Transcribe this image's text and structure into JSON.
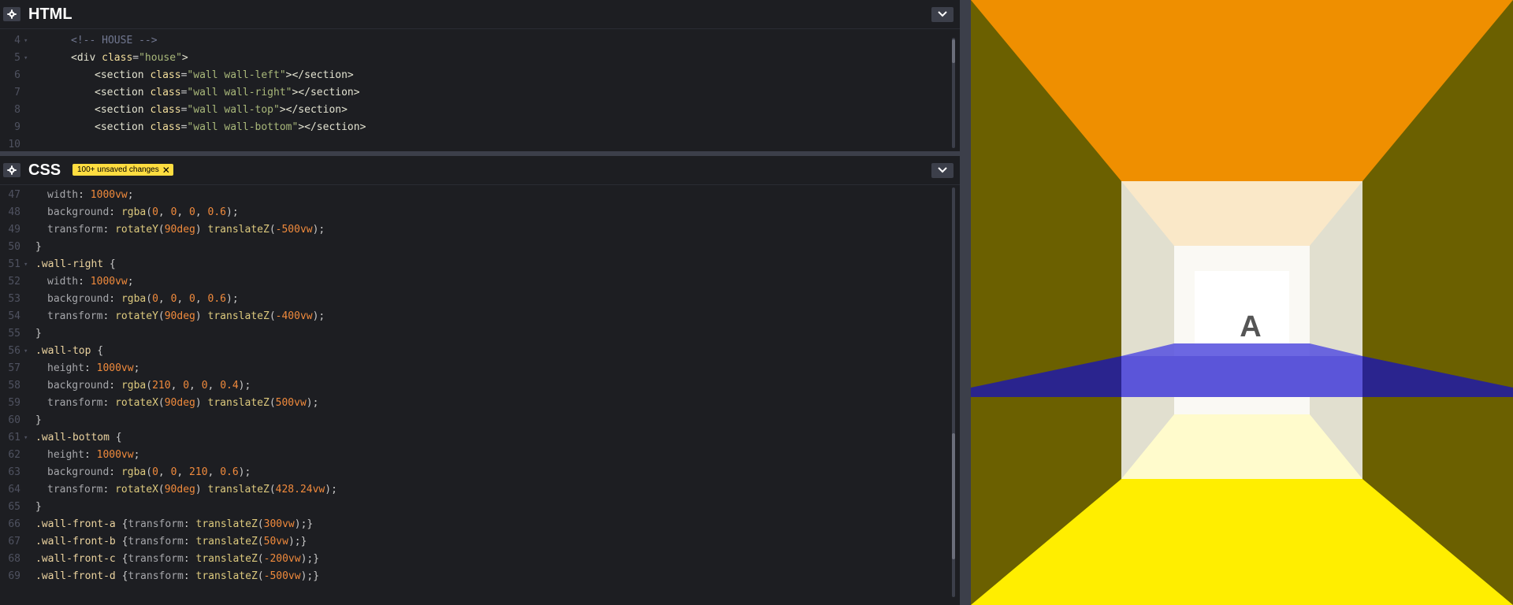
{
  "html_panel": {
    "title": "HTML",
    "lines": [
      {
        "n": "4",
        "fold": true,
        "indent": 3,
        "tokens": [
          {
            "t": "<!-- HOUSE -->",
            "c": "com"
          }
        ]
      },
      {
        "n": "5",
        "fold": true,
        "indent": 3,
        "tokens": [
          {
            "t": "<div ",
            "c": "tag"
          },
          {
            "t": "class",
            "c": "attr"
          },
          {
            "t": "=",
            "c": "punc"
          },
          {
            "t": "\"house\"",
            "c": "str"
          },
          {
            "t": ">",
            "c": "tag"
          }
        ]
      },
      {
        "n": "6",
        "fold": false,
        "indent": 5,
        "tokens": [
          {
            "t": "<section ",
            "c": "tag"
          },
          {
            "t": "class",
            "c": "attr"
          },
          {
            "t": "=",
            "c": "punc"
          },
          {
            "t": "\"wall wall-left\"",
            "c": "str"
          },
          {
            "t": "></section>",
            "c": "tag"
          }
        ]
      },
      {
        "n": "7",
        "fold": false,
        "indent": 5,
        "tokens": [
          {
            "t": "<section ",
            "c": "tag"
          },
          {
            "t": "class",
            "c": "attr"
          },
          {
            "t": "=",
            "c": "punc"
          },
          {
            "t": "\"wall wall-right\"",
            "c": "str"
          },
          {
            "t": "></section>",
            "c": "tag"
          }
        ]
      },
      {
        "n": "8",
        "fold": false,
        "indent": 5,
        "tokens": [
          {
            "t": "<section ",
            "c": "tag"
          },
          {
            "t": "class",
            "c": "attr"
          },
          {
            "t": "=",
            "c": "punc"
          },
          {
            "t": "\"wall wall-top\"",
            "c": "str"
          },
          {
            "t": "></section>",
            "c": "tag"
          }
        ]
      },
      {
        "n": "9",
        "fold": false,
        "indent": 5,
        "tokens": [
          {
            "t": "<section ",
            "c": "tag"
          },
          {
            "t": "class",
            "c": "attr"
          },
          {
            "t": "=",
            "c": "punc"
          },
          {
            "t": "\"wall wall-bottom\"",
            "c": "str"
          },
          {
            "t": "></section>",
            "c": "tag"
          }
        ]
      },
      {
        "n": "10",
        "fold": false,
        "indent": 0,
        "tokens": []
      }
    ]
  },
  "css_panel": {
    "title": "CSS",
    "badge": "100+ unsaved changes",
    "lines": [
      {
        "n": "47",
        "fold": false,
        "indent": 1,
        "tokens": [
          {
            "t": "width",
            "c": "prop"
          },
          {
            "t": ": ",
            "c": "punc"
          },
          {
            "t": "1000vw",
            "c": "num"
          },
          {
            "t": ";",
            "c": "punc"
          }
        ]
      },
      {
        "n": "48",
        "fold": false,
        "indent": 1,
        "tokens": [
          {
            "t": "background",
            "c": "prop"
          },
          {
            "t": ": ",
            "c": "punc"
          },
          {
            "t": "rgba",
            "c": "fn"
          },
          {
            "t": "(",
            "c": "punc"
          },
          {
            "t": "0",
            "c": "num"
          },
          {
            "t": ", ",
            "c": "punc"
          },
          {
            "t": "0",
            "c": "num"
          },
          {
            "t": ", ",
            "c": "punc"
          },
          {
            "t": "0",
            "c": "num"
          },
          {
            "t": ", ",
            "c": "punc"
          },
          {
            "t": "0.6",
            "c": "num"
          },
          {
            "t": ");",
            "c": "punc"
          }
        ]
      },
      {
        "n": "49",
        "fold": false,
        "indent": 1,
        "tokens": [
          {
            "t": "transform",
            "c": "prop"
          },
          {
            "t": ": ",
            "c": "punc"
          },
          {
            "t": "rotateY",
            "c": "fn"
          },
          {
            "t": "(",
            "c": "punc"
          },
          {
            "t": "90deg",
            "c": "num"
          },
          {
            "t": ") ",
            "c": "punc"
          },
          {
            "t": "translateZ",
            "c": "fn"
          },
          {
            "t": "(",
            "c": "punc"
          },
          {
            "t": "-500vw",
            "c": "num"
          },
          {
            "t": ");",
            "c": "punc"
          }
        ]
      },
      {
        "n": "50",
        "fold": false,
        "indent": 0,
        "tokens": [
          {
            "t": "}",
            "c": "punc"
          }
        ]
      },
      {
        "n": "51",
        "fold": true,
        "indent": 0,
        "tokens": [
          {
            "t": ".wall-right",
            "c": "sel"
          },
          {
            "t": " {",
            "c": "punc"
          }
        ]
      },
      {
        "n": "52",
        "fold": false,
        "indent": 1,
        "tokens": [
          {
            "t": "width",
            "c": "prop"
          },
          {
            "t": ": ",
            "c": "punc"
          },
          {
            "t": "1000vw",
            "c": "num"
          },
          {
            "t": ";",
            "c": "punc"
          }
        ]
      },
      {
        "n": "53",
        "fold": false,
        "indent": 1,
        "tokens": [
          {
            "t": "background",
            "c": "prop"
          },
          {
            "t": ": ",
            "c": "punc"
          },
          {
            "t": "rgba",
            "c": "fn"
          },
          {
            "t": "(",
            "c": "punc"
          },
          {
            "t": "0",
            "c": "num"
          },
          {
            "t": ", ",
            "c": "punc"
          },
          {
            "t": "0",
            "c": "num"
          },
          {
            "t": ", ",
            "c": "punc"
          },
          {
            "t": "0",
            "c": "num"
          },
          {
            "t": ", ",
            "c": "punc"
          },
          {
            "t": "0.6",
            "c": "num"
          },
          {
            "t": ");",
            "c": "punc"
          }
        ]
      },
      {
        "n": "54",
        "fold": false,
        "indent": 1,
        "tokens": [
          {
            "t": "transform",
            "c": "prop"
          },
          {
            "t": ": ",
            "c": "punc"
          },
          {
            "t": "rotateY",
            "c": "fn"
          },
          {
            "t": "(",
            "c": "punc"
          },
          {
            "t": "90deg",
            "c": "num"
          },
          {
            "t": ") ",
            "c": "punc"
          },
          {
            "t": "translateZ",
            "c": "fn"
          },
          {
            "t": "(",
            "c": "punc"
          },
          {
            "t": "-400vw",
            "c": "num"
          },
          {
            "t": ");",
            "c": "punc"
          }
        ]
      },
      {
        "n": "55",
        "fold": false,
        "indent": 0,
        "tokens": [
          {
            "t": "}",
            "c": "punc"
          }
        ]
      },
      {
        "n": "56",
        "fold": true,
        "indent": 0,
        "tokens": [
          {
            "t": ".wall-top",
            "c": "sel"
          },
          {
            "t": " {",
            "c": "punc"
          }
        ]
      },
      {
        "n": "57",
        "fold": false,
        "indent": 1,
        "tokens": [
          {
            "t": "height",
            "c": "prop"
          },
          {
            "t": ": ",
            "c": "punc"
          },
          {
            "t": "1000vw",
            "c": "num"
          },
          {
            "t": ";",
            "c": "punc"
          }
        ]
      },
      {
        "n": "58",
        "fold": false,
        "indent": 1,
        "tokens": [
          {
            "t": "background",
            "c": "prop"
          },
          {
            "t": ": ",
            "c": "punc"
          },
          {
            "t": "rgba",
            "c": "fn"
          },
          {
            "t": "(",
            "c": "punc"
          },
          {
            "t": "210",
            "c": "num"
          },
          {
            "t": ", ",
            "c": "punc"
          },
          {
            "t": "0",
            "c": "num"
          },
          {
            "t": ", ",
            "c": "punc"
          },
          {
            "t": "0",
            "c": "num"
          },
          {
            "t": ", ",
            "c": "punc"
          },
          {
            "t": "0.4",
            "c": "num"
          },
          {
            "t": ");",
            "c": "punc"
          }
        ]
      },
      {
        "n": "59",
        "fold": false,
        "indent": 1,
        "tokens": [
          {
            "t": "transform",
            "c": "prop"
          },
          {
            "t": ": ",
            "c": "punc"
          },
          {
            "t": "rotateX",
            "c": "fn"
          },
          {
            "t": "(",
            "c": "punc"
          },
          {
            "t": "90deg",
            "c": "num"
          },
          {
            "t": ") ",
            "c": "punc"
          },
          {
            "t": "translateZ",
            "c": "fn"
          },
          {
            "t": "(",
            "c": "punc"
          },
          {
            "t": "500vw",
            "c": "num"
          },
          {
            "t": ");",
            "c": "punc"
          }
        ]
      },
      {
        "n": "60",
        "fold": false,
        "indent": 0,
        "tokens": [
          {
            "t": "}",
            "c": "punc"
          }
        ]
      },
      {
        "n": "61",
        "fold": true,
        "indent": 0,
        "tokens": [
          {
            "t": ".wall-bottom",
            "c": "sel"
          },
          {
            "t": " {",
            "c": "punc"
          }
        ]
      },
      {
        "n": "62",
        "fold": false,
        "indent": 1,
        "tokens": [
          {
            "t": "height",
            "c": "prop"
          },
          {
            "t": ": ",
            "c": "punc"
          },
          {
            "t": "1000vw",
            "c": "num"
          },
          {
            "t": ";",
            "c": "punc"
          }
        ]
      },
      {
        "n": "63",
        "fold": false,
        "indent": 1,
        "tokens": [
          {
            "t": "background",
            "c": "prop"
          },
          {
            "t": ": ",
            "c": "punc"
          },
          {
            "t": "rgba",
            "c": "fn"
          },
          {
            "t": "(",
            "c": "punc"
          },
          {
            "t": "0",
            "c": "num"
          },
          {
            "t": ", ",
            "c": "punc"
          },
          {
            "t": "0",
            "c": "num"
          },
          {
            "t": ", ",
            "c": "punc"
          },
          {
            "t": "210",
            "c": "num"
          },
          {
            "t": ", ",
            "c": "punc"
          },
          {
            "t": "0.6",
            "c": "num"
          },
          {
            "t": ");",
            "c": "punc"
          }
        ]
      },
      {
        "n": "64",
        "fold": false,
        "indent": 1,
        "tokens": [
          {
            "t": "transform",
            "c": "prop"
          },
          {
            "t": ": ",
            "c": "punc"
          },
          {
            "t": "rotateX",
            "c": "fn"
          },
          {
            "t": "(",
            "c": "punc"
          },
          {
            "t": "90deg",
            "c": "num"
          },
          {
            "t": ") ",
            "c": "punc"
          },
          {
            "t": "translateZ",
            "c": "fn"
          },
          {
            "t": "(",
            "c": "punc"
          },
          {
            "t": "428.24vw",
            "c": "num"
          },
          {
            "t": ");",
            "c": "punc"
          }
        ]
      },
      {
        "n": "65",
        "fold": false,
        "indent": 0,
        "tokens": [
          {
            "t": "}",
            "c": "punc"
          }
        ]
      },
      {
        "n": "66",
        "fold": false,
        "indent": 0,
        "tokens": [
          {
            "t": ".wall-front-a",
            "c": "sel"
          },
          {
            "t": " {",
            "c": "punc"
          },
          {
            "t": "transform",
            "c": "prop"
          },
          {
            "t": ": ",
            "c": "punc"
          },
          {
            "t": "translateZ",
            "c": "fn"
          },
          {
            "t": "(",
            "c": "punc"
          },
          {
            "t": "300vw",
            "c": "num"
          },
          {
            "t": ");}",
            "c": "punc"
          }
        ]
      },
      {
        "n": "67",
        "fold": false,
        "indent": 0,
        "tokens": [
          {
            "t": ".wall-front-b",
            "c": "sel"
          },
          {
            "t": " {",
            "c": "punc"
          },
          {
            "t": "transform",
            "c": "prop"
          },
          {
            "t": ": ",
            "c": "punc"
          },
          {
            "t": "translateZ",
            "c": "fn"
          },
          {
            "t": "(",
            "c": "punc"
          },
          {
            "t": "50vw",
            "c": "num"
          },
          {
            "t": ");}",
            "c": "punc"
          }
        ]
      },
      {
        "n": "68",
        "fold": false,
        "indent": 0,
        "tokens": [
          {
            "t": ".wall-front-c",
            "c": "sel"
          },
          {
            "t": " {",
            "c": "punc"
          },
          {
            "t": "transform",
            "c": "prop"
          },
          {
            "t": ": ",
            "c": "punc"
          },
          {
            "t": "translateZ",
            "c": "fn"
          },
          {
            "t": "(",
            "c": "punc"
          },
          {
            "t": "-200vw",
            "c": "num"
          },
          {
            "t": ");}",
            "c": "punc"
          }
        ]
      },
      {
        "n": "69",
        "fold": false,
        "indent": 0,
        "tokens": [
          {
            "t": ".wall-front-d",
            "c": "sel"
          },
          {
            "t": " {",
            "c": "punc"
          },
          {
            "t": "transform",
            "c": "prop"
          },
          {
            "t": ": ",
            "c": "punc"
          },
          {
            "t": "translateZ",
            "c": "fn"
          },
          {
            "t": "(",
            "c": "punc"
          },
          {
            "t": "-500vw",
            "c": "num"
          },
          {
            "t": ");}",
            "c": "punc"
          }
        ]
      }
    ]
  },
  "preview": {
    "letter": "A",
    "colors": {
      "side_walls": "#6b6000",
      "ceiling": "#ef8f00",
      "floor": "#ffee00",
      "water_band": "#2a248e"
    }
  },
  "icons": {
    "settings": "gear-icon",
    "collapse": "chevron-down-icon",
    "dismiss": "close-icon"
  }
}
